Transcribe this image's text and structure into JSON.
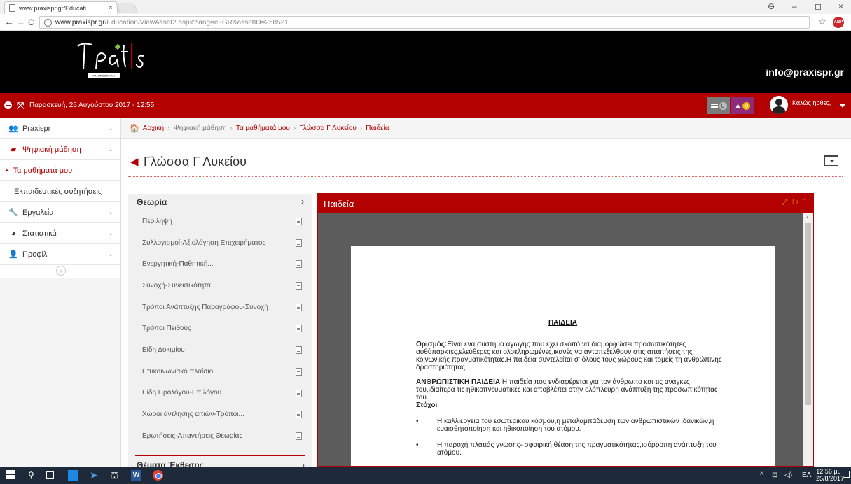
{
  "browser": {
    "tab_title": "www.praxispr.gr/Educati",
    "url_host": "www.praxispr.gr",
    "url_path": "/Education/ViewAsset2.aspx?lang=el-GR&assetID=258521",
    "back": "←",
    "forward": "→",
    "reload": "C",
    "info": "i",
    "star": "☆",
    "ext_label": "ABP",
    "close": "×",
    "account": "⊖",
    "minimize": "–",
    "maximize": "◻",
    "window_close": "×"
  },
  "header": {
    "email": "info@praxispr.gr",
    "logo_tagline": "ΚΑΙ ΠΡΟΟΠΤΙΚΗ"
  },
  "topbar": {
    "date": "Παρασκευή, 25 Αυγούστου 2017 - 12:55",
    "messages_count": "0",
    "notifications_count": "0",
    "greeting": "Καλώς ήρθες,"
  },
  "sidebar": {
    "items": [
      {
        "label": "Praxispr",
        "icon": "users-icon",
        "glyph": "👥"
      },
      {
        "label": "Ψηφιακή μάθηση",
        "icon": "book-icon",
        "glyph": "▰"
      },
      {
        "label": "Τα μαθήματά μου"
      },
      {
        "label": "Εκπαιδευτικές συζητήσεις"
      },
      {
        "label": "Εργαλεία",
        "icon": "wrench-icon",
        "glyph": "🔧"
      },
      {
        "label": "Στατιστικά",
        "icon": "pie-chart-icon",
        "glyph": "◕"
      },
      {
        "label": "Προφίλ",
        "icon": "user-icon",
        "glyph": "👤"
      }
    ],
    "collapse": "«"
  },
  "breadcrumb": {
    "items": [
      "Αρχική",
      "Ψηφιακή μάθηση",
      "Τα μαθήματά μου",
      "Γλώσσα Γ Λυκείου",
      "Παιδεία"
    ],
    "separator": "›"
  },
  "page": {
    "title": "Γλώσσα Γ Λυκείου"
  },
  "theory": {
    "header": "Θεωρία",
    "items": [
      "Περίληψη",
      "Συλλογισμοί-Αξιολόγηση Επιχειρήματος",
      "Ενεργητική-Παθητική...",
      "Συνοχή-Συνεκτικότητα",
      "Τρόποι Ανάπτυξης Παραγράφου-Συνοχή",
      "Τρόποι Πειθούς",
      "Είδη Δοκιμίου",
      "Επικοινωνιακό πλαίσιο",
      "Είδη Προλόγου-Επιλόγου",
      "Χώροι άντλησης αιτιών-Τρόποι...",
      "Ερωτήσεις-Απαντήσεις Θεωρίας"
    ],
    "next_section": "Θέματα Έκθεσης"
  },
  "viewer": {
    "title": "Παιδεία",
    "tools": "⤢ ↻ ⌃",
    "document": {
      "heading": "ΠΑΙΔΕΙΑ",
      "def_label": "Ορισμός:",
      "def_text": "Είναι ένα σύστημα αγωγής που έχει σκοπό να διαμορφώσει προσωπικότητες αυθύπαρκτες,ελεύθερες και ολοκληρωμένες,ικανές να ανταπεξέλθουν στις απαιτήσεις της κοινωνικής πραγματικότητας.Η παιδεία συντελείται σ' όλους τους χώρους και τομείς τη ανθρώπινης δραστηριότητας.",
      "hum_label": "ΑΝΘΡΩΠΙΣΤΙΚΗ ΠΑΙΔΕΙΑ",
      "hum_text": ":Η παιδεία που ενδιαφέρεται για τον άνθρωπο και τις ανάγκες του,ιδιαίτερα τις ηθικοπνευματικές και αποβλέπει στην ολόπλευρη ανάπτυξη της προσωπικότητας του.",
      "goals_label": "Στόχοι",
      "goals": [
        "Η καλλιέργεια του εσωτερικού κόσμου,η μεταλαμπάδευση των ανθρωπιστικών ιδανικών,η ευαισθητοποίηση και ηθικοποίηση του ατόμου.",
        "Η παροχή πλατιάς γνώσης- σφαιρική θέαση της πραγματικότητας,ισόρροπη ανάπτυξη του ατόμου."
      ]
    }
  },
  "taskbar": {
    "tray_caret": "^",
    "tray_lang": "ΕΛ",
    "time": "12:56 μμ",
    "date": "25/8/2017",
    "word_label": "W"
  }
}
